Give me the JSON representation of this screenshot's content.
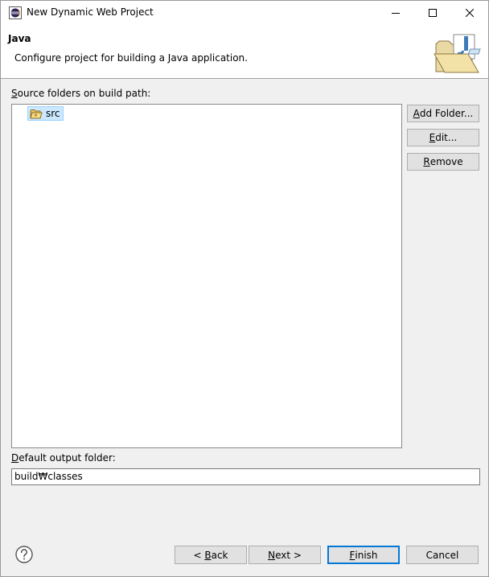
{
  "window": {
    "title": "New Dynamic Web Project"
  },
  "header": {
    "title": "Java",
    "description": "Configure project for building a Java application."
  },
  "source_section": {
    "label_mnemonic": "S",
    "label_rest": "ource folders on build path:",
    "items": [
      {
        "label": "src",
        "selected": true
      }
    ]
  },
  "side_buttons": {
    "add_folder": {
      "mnemonic": "A",
      "rest": "dd Folder..."
    },
    "edit": {
      "mnemonic": "E",
      "rest": "dit..."
    },
    "remove": {
      "mnemonic": "R",
      "rest": "emove"
    }
  },
  "output_section": {
    "label_mnemonic": "D",
    "label_rest": "efault output folder:",
    "value": "build₩classes"
  },
  "footer": {
    "back": {
      "prefix": "< ",
      "mnemonic": "B",
      "rest": "ack"
    },
    "next": {
      "mnemonic": "N",
      "rest": "ext >"
    },
    "finish": {
      "mnemonic": "F",
      "rest": "inish"
    },
    "cancel": {
      "label": "Cancel"
    }
  },
  "icons": {
    "app": "eclipse-icon",
    "banner": "java-folder-banner-icon",
    "folder": "package-folder-icon",
    "help": "help-icon",
    "minimize": "minimize-icon",
    "maximize": "maximize-icon",
    "close": "close-icon"
  },
  "colors": {
    "selection_bg": "#cce8ff",
    "default_button_border": "#0078d7",
    "button_bg": "#e1e1e1"
  }
}
